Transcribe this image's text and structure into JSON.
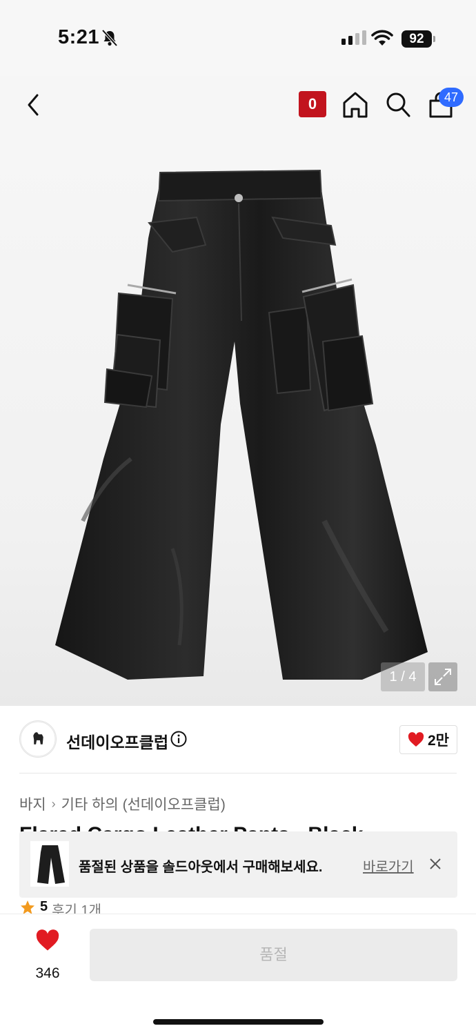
{
  "status_bar": {
    "time": "5:21",
    "battery": "92",
    "icons": [
      "bell-slash-icon",
      "signal-icon",
      "wifi-icon",
      "battery-icon"
    ]
  },
  "nav": {
    "back_icon": "chevron-left-icon",
    "zero_badge": "0",
    "home_icon": "home-icon",
    "search_icon": "search-icon",
    "cart_icon": "shopping-bag-icon",
    "cart_count": "47"
  },
  "gallery": {
    "page_indicator": "1 / 4",
    "expand_icon": "expand-icon"
  },
  "brand": {
    "name": "선데이오프클럽",
    "info_icon": "info-icon",
    "like_count": "2만"
  },
  "breadcrumb": {
    "level1": "바지",
    "level2": "기타 하의 (선데이오프클럽)"
  },
  "product": {
    "title_partial": "Flared Cargo Leather Pants - Black"
  },
  "soldout_banner": {
    "message": "품절된 상품을 솔드아웃에서 구매해보세요.",
    "link_label": "바로가기"
  },
  "rating": {
    "score": "5",
    "reviews": "후기 1개"
  },
  "bottom_bar": {
    "like_count": "346",
    "buy_label": "품절"
  },
  "colors": {
    "accent_red": "#c2141e",
    "badge_blue": "#2f6bff",
    "heart_red": "#e11b22",
    "star_orange": "#f29a1e"
  }
}
